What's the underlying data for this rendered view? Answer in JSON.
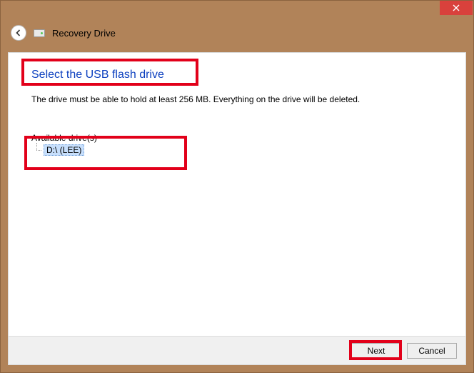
{
  "titlebar": {
    "close_aria": "Close"
  },
  "header": {
    "back_aria": "Back",
    "drive_icon_name": "drive-icon",
    "title": "Recovery Drive"
  },
  "page": {
    "heading": "Select the USB flash drive",
    "description": "The drive must be able to hold at least 256 MB. Everything on the drive will be deleted."
  },
  "drives": {
    "label": "Available drive(s)",
    "items": [
      {
        "label": "D:\\ (LEE)",
        "selected": true
      }
    ]
  },
  "footer": {
    "next_label": "Next",
    "cancel_label": "Cancel"
  }
}
